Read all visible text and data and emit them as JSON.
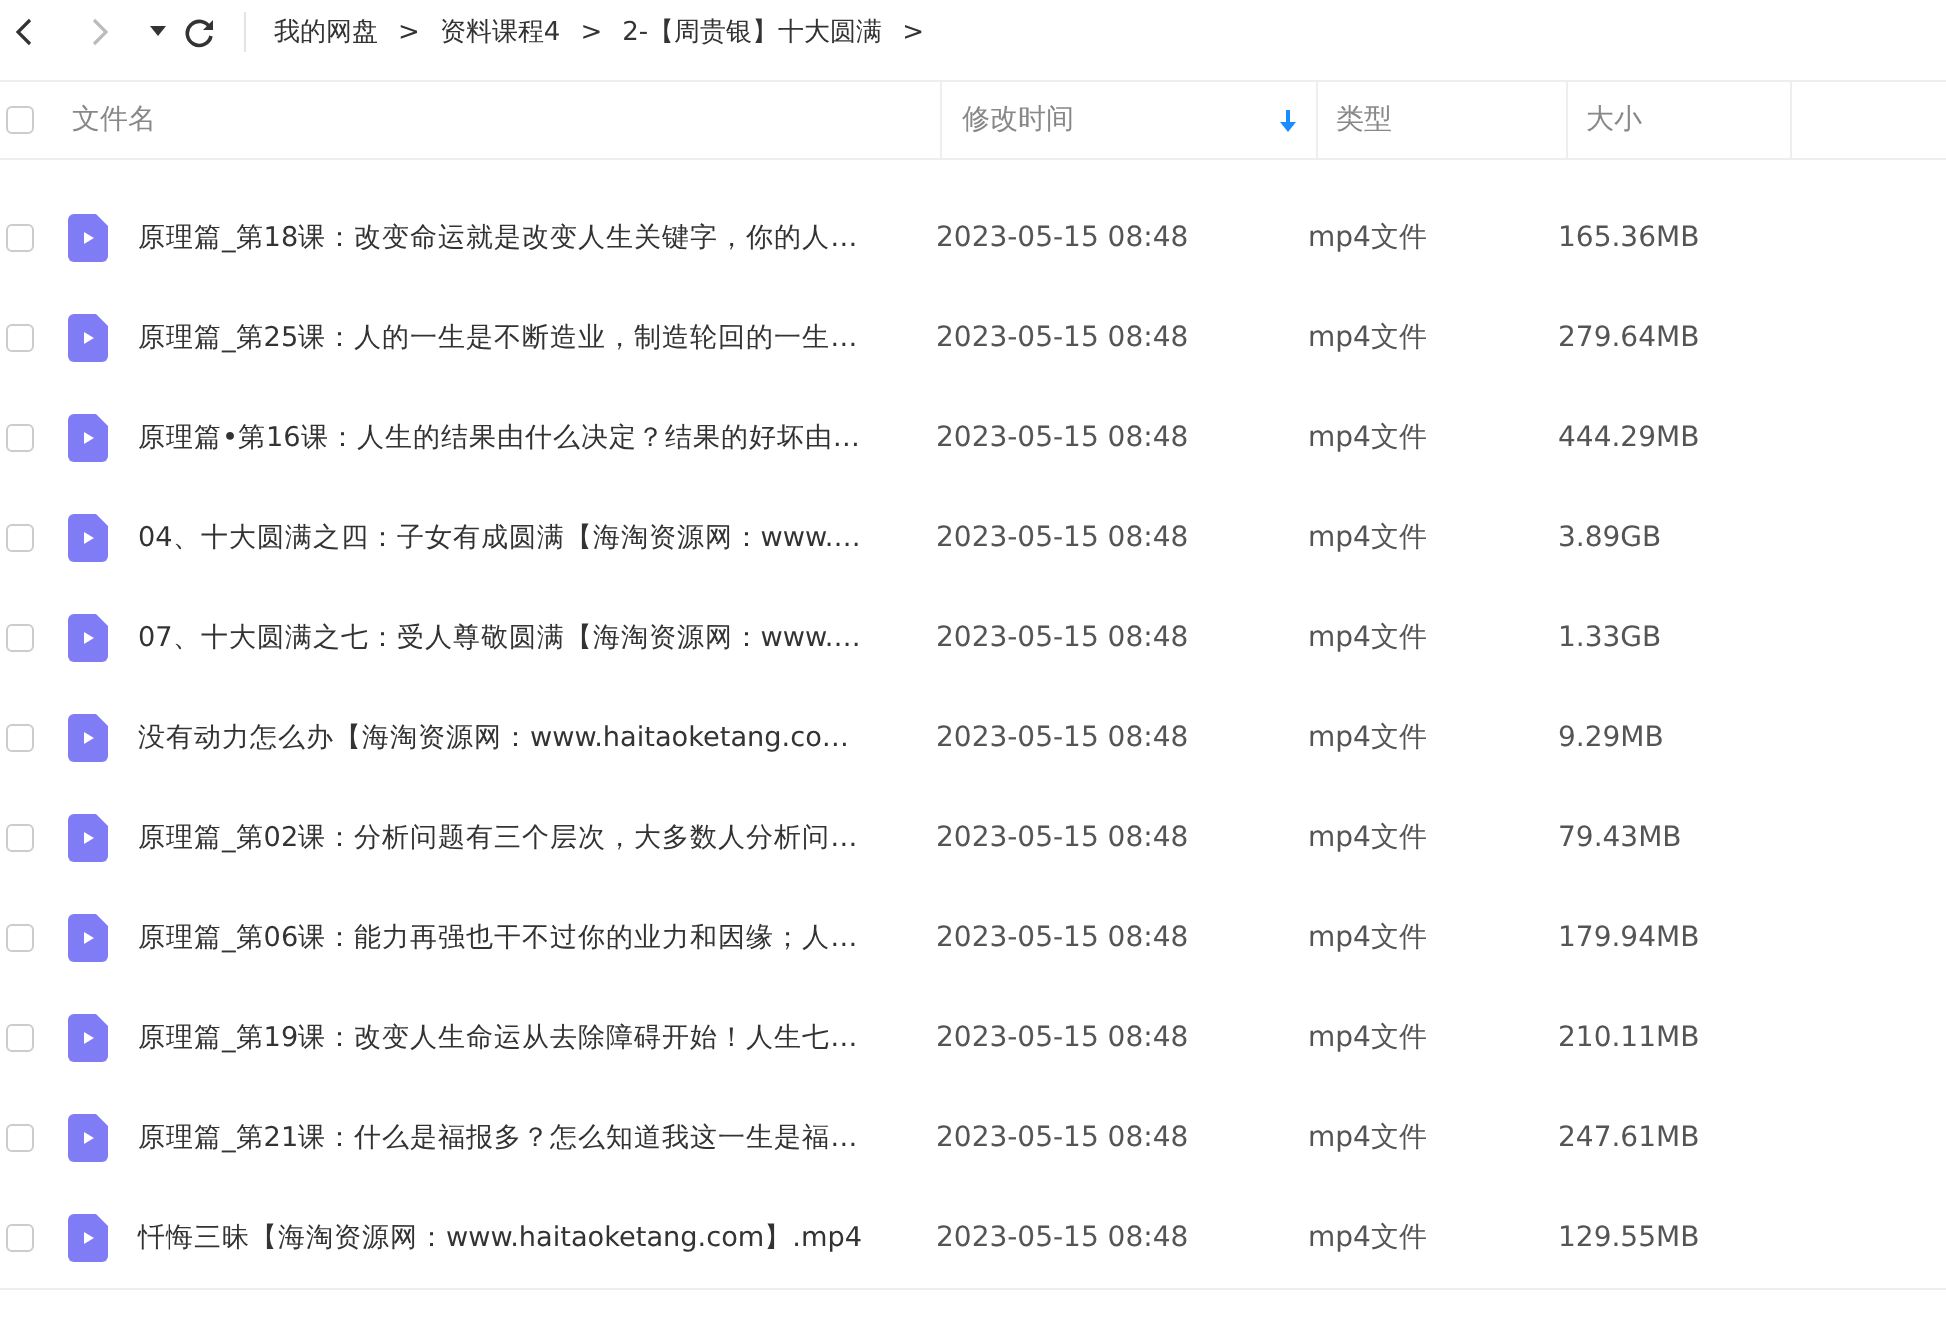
{
  "toolbar": {
    "breadcrumbs": [
      {
        "label": "我的网盘"
      },
      {
        "label": "资料课程4"
      },
      {
        "label": "2-【周贵银】十大圆满"
      }
    ],
    "separator": ">"
  },
  "table": {
    "select_all": {
      "checked": false
    },
    "columns": [
      {
        "label": "文件名",
        "sorted": false
      },
      {
        "label": "修改时间",
        "sorted": true
      },
      {
        "label": "类型",
        "sorted": false
      },
      {
        "label": "大小",
        "sorted": false
      }
    ],
    "rows": [
      {
        "checked": false,
        "name": "原理篇_第18课：改变命运就是改变人生关键字，你的人…",
        "modified": "2023-05-15 08:48",
        "type": "mp4文件",
        "size": "165.36MB"
      },
      {
        "checked": false,
        "name": "原理篇_第25课：人的一生是不断造业，制造轮回的一生…",
        "modified": "2023-05-15 08:48",
        "type": "mp4文件",
        "size": "279.64MB"
      },
      {
        "checked": false,
        "name": "原理篇•第16课：人生的结果由什么决定？结果的好坏由…",
        "modified": "2023-05-15 08:48",
        "type": "mp4文件",
        "size": "444.29MB"
      },
      {
        "checked": false,
        "name": "04、十大圆满之四：子女有成圆满【海淘资源网：www.…",
        "modified": "2023-05-15 08:48",
        "type": "mp4文件",
        "size": "3.89GB"
      },
      {
        "checked": false,
        "name": "07、十大圆满之七：受人尊敬圆满【海淘资源网：www.…",
        "modified": "2023-05-15 08:48",
        "type": "mp4文件",
        "size": "1.33GB"
      },
      {
        "checked": false,
        "name": "没有动力怎么办【海淘资源网：www.haitaoketang.co…",
        "modified": "2023-05-15 08:48",
        "type": "mp4文件",
        "size": "9.29MB"
      },
      {
        "checked": false,
        "name": "原理篇_第02课：分析问题有三个层次，大多数人分析问…",
        "modified": "2023-05-15 08:48",
        "type": "mp4文件",
        "size": "79.43MB"
      },
      {
        "checked": false,
        "name": "原理篇_第06课：能力再强也干不过你的业力和因缘；人…",
        "modified": "2023-05-15 08:48",
        "type": "mp4文件",
        "size": "179.94MB"
      },
      {
        "checked": false,
        "name": "原理篇_第19课：改变人生命运从去除障碍开始！人生七…",
        "modified": "2023-05-15 08:48",
        "type": "mp4文件",
        "size": "210.11MB"
      },
      {
        "checked": false,
        "name": "原理篇_第21课：什么是福报多？怎么知道我这一生是福…",
        "modified": "2023-05-15 08:48",
        "type": "mp4文件",
        "size": "247.61MB"
      },
      {
        "checked": false,
        "name": "忏悔三昧【海淘资源网：www.haitaoketang.com】.mp4",
        "modified": "2023-05-15 08:48",
        "type": "mp4文件",
        "size": "129.55MB"
      }
    ]
  }
}
